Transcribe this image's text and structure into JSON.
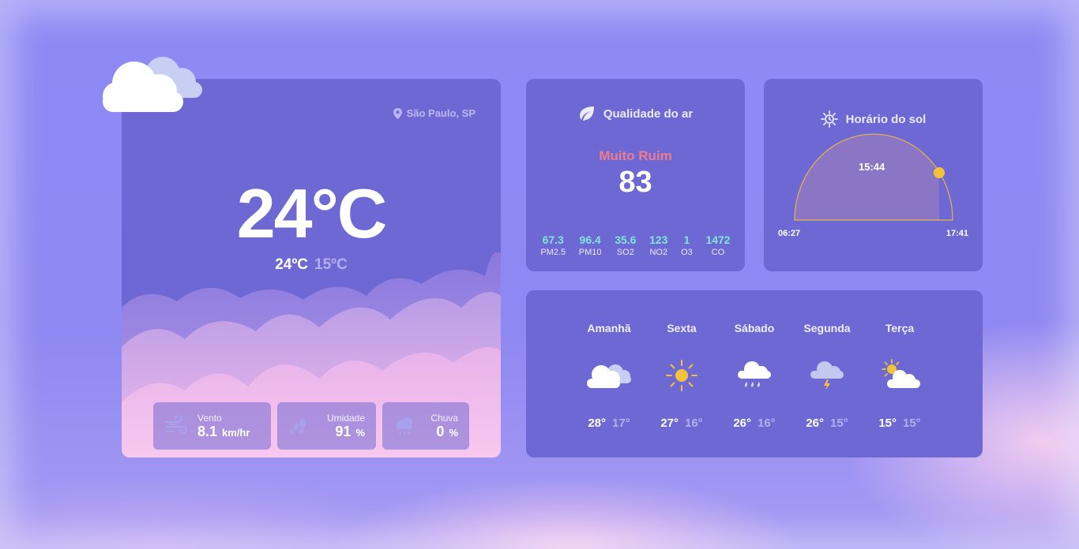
{
  "location": "São Paulo, SP",
  "current": {
    "temp": "24°C",
    "max": "24ºC",
    "min": "15ºC"
  },
  "metrics": [
    {
      "label": "Vento",
      "value": "8.1",
      "unit": "km/hr",
      "icon": "wind-icon"
    },
    {
      "label": "Umidade",
      "value": "91",
      "unit": "%",
      "icon": "humidity-icon"
    },
    {
      "label": "Chuva",
      "value": "0",
      "unit": "%",
      "icon": "rain-cloud-icon"
    }
  ],
  "air": {
    "title": "Qualidade do ar",
    "status": "Muito Ruim",
    "index": "83",
    "pollutants": [
      {
        "value": "67.3",
        "name": "PM2.5"
      },
      {
        "value": "96.4",
        "name": "PM10"
      },
      {
        "value": "35.6",
        "name": "SO2"
      },
      {
        "value": "123",
        "name": "NO2"
      },
      {
        "value": "1",
        "name": "O3"
      },
      {
        "value": "1472",
        "name": "CO"
      }
    ]
  },
  "sun": {
    "title": "Horário do sol",
    "now": "15:44",
    "sunrise": "06:27",
    "sunset": "17:41",
    "progress": 0.75
  },
  "forecast": [
    {
      "day": "Amanhã",
      "max": "28°",
      "min": "17°",
      "icon": "partly-cloudy-icon"
    },
    {
      "day": "Sexta",
      "max": "27°",
      "min": "16°",
      "icon": "sun-icon"
    },
    {
      "day": "Sábado",
      "max": "26°",
      "min": "16°",
      "icon": "rain-icon"
    },
    {
      "day": "Segunda",
      "max": "26°",
      "min": "15°",
      "icon": "storm-icon"
    },
    {
      "day": "Terça",
      "max": "15°",
      "min": "15°",
      "icon": "sun-cloud-icon"
    }
  ],
  "colors": {
    "card": "#6d68d3",
    "status_bad": "#ef7c8e",
    "pollutant": "#7fe6d8",
    "sun": "#f3c23d"
  }
}
